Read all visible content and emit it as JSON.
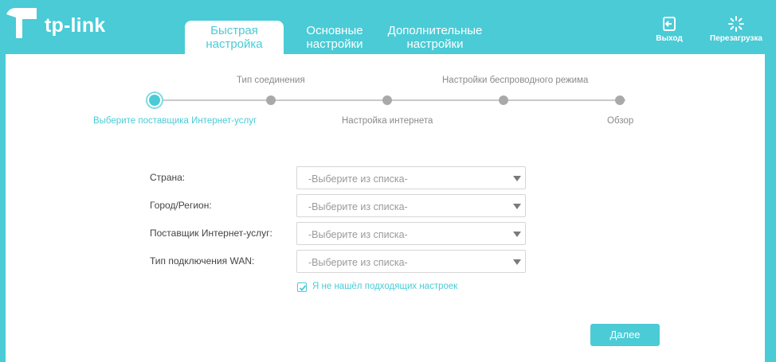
{
  "brand": {
    "name": "tp-link"
  },
  "tabs": [
    {
      "line1": "Быстрая",
      "line2": "настройка",
      "active": true
    },
    {
      "line1": "Основные",
      "line2": "настройки",
      "active": false
    },
    {
      "line1": "Дополнительные",
      "line2": "настройки",
      "active": false
    }
  ],
  "header_buttons": {
    "logout": {
      "label": "Выход",
      "icon": "logout-icon"
    },
    "reboot": {
      "label": "Перезагрузка",
      "icon": "reboot-icon"
    }
  },
  "stepper": {
    "top_labels": [
      "Тип соединения",
      "Настройки беспроводного режима"
    ],
    "bottom_labels": [
      "Выберите поставщика Интернет-услуг",
      "Настройка интернета",
      "Обзор"
    ],
    "current_step": 1,
    "total_steps": 5
  },
  "form": {
    "fields": [
      {
        "label": "Страна:",
        "value": "-Выберите из списка-"
      },
      {
        "label": "Город/Регион:",
        "value": "-Выберите из списка-"
      },
      {
        "label": "Поставщик Интернет-услуг:",
        "value": "-Выберите из списка-"
      },
      {
        "label": "Тип подключения WAN:",
        "value": "-Выберите из списка-"
      }
    ],
    "checkbox": {
      "label": "Я не нашёл подходящих настроек",
      "checked": true
    }
  },
  "actions": {
    "next_label": "Далее"
  },
  "colors": {
    "accent": "#4acbd6",
    "inactive_dot": "#a9a9a9",
    "line": "#c9c9c9"
  }
}
